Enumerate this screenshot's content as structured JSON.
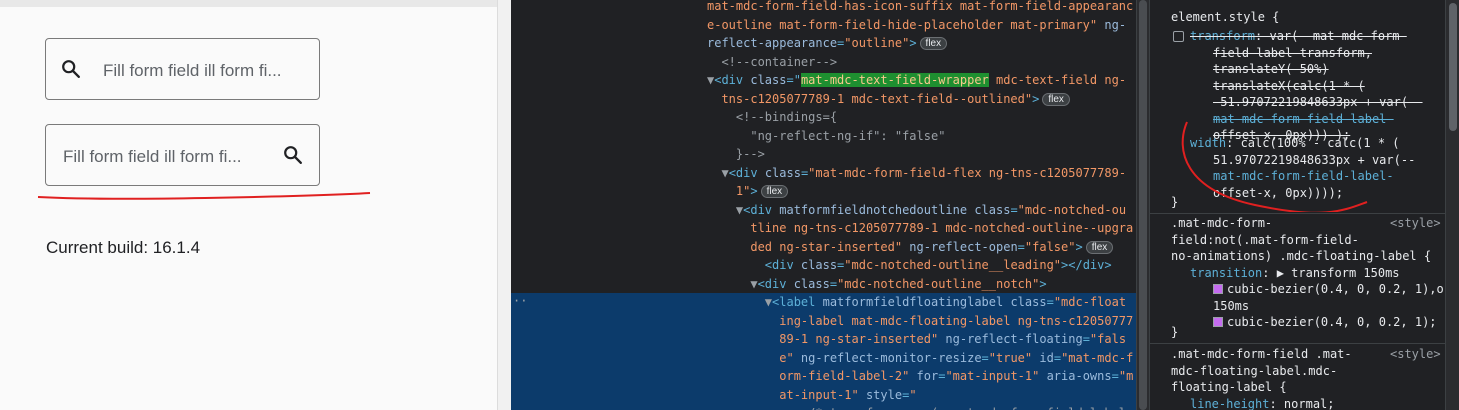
{
  "page": {
    "field1_placeholder": "Fill form field ill form fi...",
    "field2_placeholder": "Fill form field ill form fi...",
    "build_text": "Current build: 16.1.4"
  },
  "elements": {
    "badge": "flex",
    "lines": [
      [
        {
          "c": "av",
          "t": "mat-mdc-form-field-has-icon-suffix mat-form-field-appearanc"
        }
      ],
      [
        {
          "c": "av",
          "t": "e-outline mat-form-field-hide-placeholder mat-primary\""
        },
        {
          "c": "an",
          "t": " ng-"
        }
      ],
      [
        {
          "c": "an",
          "t": "reflect-appearance"
        },
        {
          "c": "tag",
          "t": "="
        },
        {
          "c": "av",
          "t": "\"outline\""
        },
        {
          "c": "tag",
          "t": ">"
        },
        {
          "c": "pill",
          "t": "flex"
        }
      ],
      [
        {
          "c": "cm",
          "t": "  <!--container-->"
        }
      ],
      [
        {
          "c": "tri",
          "t": "▼"
        },
        {
          "c": "tag",
          "t": "<div "
        },
        {
          "c": "an",
          "t": "class"
        },
        {
          "c": "tag",
          "t": "=\""
        },
        {
          "c": "hl",
          "t": "mat-mdc-text-field-wrapper"
        },
        {
          "c": "av",
          "t": " mdc-text-field ng-"
        }
      ],
      [
        {
          "c": "av",
          "t": "  tns-c1205077789-1 mdc-text-field--outlined\""
        },
        {
          "c": "tag",
          "t": ">"
        },
        {
          "c": "pill",
          "t": "flex"
        }
      ],
      [
        {
          "c": "cm",
          "t": "    <!--bindings={"
        }
      ],
      [
        {
          "c": "cm",
          "t": "      \"ng-reflect-ng-if\": \"false\""
        }
      ],
      [
        {
          "c": "cm",
          "t": "    }-->"
        }
      ],
      [
        {
          "c": "tri",
          "t": "  ▼"
        },
        {
          "c": "tag",
          "t": "<div "
        },
        {
          "c": "an",
          "t": "class"
        },
        {
          "c": "tag",
          "t": "="
        },
        {
          "c": "av",
          "t": "\"mat-mdc-form-field-flex ng-tns-c1205077789-"
        }
      ],
      [
        {
          "c": "av",
          "t": "    1\""
        },
        {
          "c": "tag",
          "t": ">"
        },
        {
          "c": "pill",
          "t": "flex"
        }
      ],
      [
        {
          "c": "tri",
          "t": "    ▼"
        },
        {
          "c": "tag",
          "t": "<div "
        },
        {
          "c": "an",
          "t": "matformfieldnotchedoutline class"
        },
        {
          "c": "tag",
          "t": "="
        },
        {
          "c": "av",
          "t": "\"mdc-notched-ou"
        }
      ],
      [
        {
          "c": "av",
          "t": "      tline ng-tns-c1205077789-1 mdc-notched-outline--upgra"
        }
      ],
      [
        {
          "c": "av",
          "t": "      ded ng-star-inserted\""
        },
        {
          "c": "an",
          "t": " ng-reflect-open"
        },
        {
          "c": "tag",
          "t": "="
        },
        {
          "c": "av",
          "t": "\"false\""
        },
        {
          "c": "tag",
          "t": ">"
        },
        {
          "c": "pill",
          "t": "flex"
        }
      ],
      [
        {
          "c": "tag",
          "t": "        <div "
        },
        {
          "c": "an",
          "t": "class"
        },
        {
          "c": "tag",
          "t": "="
        },
        {
          "c": "av",
          "t": "\"mdc-notched-outline__leading\""
        },
        {
          "c": "tag",
          "t": "></div>"
        }
      ],
      [
        {
          "c": "tri",
          "t": "      ▼"
        },
        {
          "c": "tag",
          "t": "<div "
        },
        {
          "c": "an",
          "t": "class"
        },
        {
          "c": "tag",
          "t": "="
        },
        {
          "c": "av",
          "t": "\"mdc-notched-outline__notch\""
        },
        {
          "c": "tag",
          "t": ">"
        }
      ],
      [
        {
          "c": "tri",
          "t": "        ▼"
        },
        {
          "c": "tag",
          "t": "<label "
        },
        {
          "c": "an",
          "t": "matformfieldfloatinglabel class"
        },
        {
          "c": "tag",
          "t": "="
        },
        {
          "c": "av",
          "t": "\"mdc-float"
        }
      ],
      [
        {
          "c": "av",
          "t": "          ing-label mat-mdc-floating-label ng-tns-c12050777"
        }
      ],
      [
        {
          "c": "av",
          "t": "          89-1 ng-star-inserted\""
        },
        {
          "c": "an",
          "t": " ng-reflect-floating"
        },
        {
          "c": "tag",
          "t": "="
        },
        {
          "c": "av",
          "t": "\"fals"
        }
      ],
      [
        {
          "c": "av",
          "t": "          e\""
        },
        {
          "c": "an",
          "t": " ng-reflect-monitor-resize"
        },
        {
          "c": "tag",
          "t": "="
        },
        {
          "c": "av",
          "t": "\"true\""
        },
        {
          "c": "an",
          "t": " id"
        },
        {
          "c": "tag",
          "t": "="
        },
        {
          "c": "av",
          "t": "\"mat-mdc-f"
        }
      ],
      [
        {
          "c": "av",
          "t": "          orm-field-label-2\""
        },
        {
          "c": "an",
          "t": " for"
        },
        {
          "c": "tag",
          "t": "="
        },
        {
          "c": "av",
          "t": "\"mat-input-1\""
        },
        {
          "c": "an",
          "t": " aria-owns"
        },
        {
          "c": "tag",
          "t": "="
        },
        {
          "c": "av",
          "t": "\"m"
        }
      ],
      [
        {
          "c": "av",
          "t": "          at-input-1\""
        },
        {
          "c": "an",
          "t": " style"
        },
        {
          "c": "tag",
          "t": "="
        },
        {
          "c": "av",
          "t": "\""
        }
      ],
      [
        {
          "c": "cm",
          "t": "              /* transform: var(--mat-mdc-form-field-label"
        }
      ]
    ],
    "selected_from": 16,
    "selected_dots": "··"
  },
  "styles": {
    "element_style_selector": "element.style {",
    "transform_prop": "transform",
    "transform_lines": [
      ": var(--mat-mdc-form-",
      "field-label-transform,",
      "translateY(-50%)",
      "translateX(calc(1 * (",
      "-51.97072219848633px + var(--",
      "mat-mdc-form-field-label-",
      "offset-x, 0px))) );"
    ],
    "width_prop": "width",
    "width_lines": [
      ": calc(100% - calc(1 * (",
      "51.97072219848633px + var(--",
      "mat-mdc-form-field-label-",
      "offset-x, 0px))));"
    ],
    "close": "}",
    "rule2_selector": [
      ".mat-mdc-form-",
      "field:not(.mat-form-field-",
      "no-animations) .mdc-floating-label {"
    ],
    "rule2_source": "<style>",
    "rule2_transition_prop": "transition",
    "rule2_transition_val": ": ▶ transform 150ms",
    "rule2_lines": [
      "cubic-bezier(0.4, 0, 0.2, 1),o",
      "150ms",
      "cubic-bezier(0.4, 0, 0.2, 1);"
    ],
    "rule3_selector": [
      ".mat-mdc-form-field .mat-",
      "mdc-floating-label.mdc-",
      "floating-label {"
    ],
    "rule3_source": "<style>",
    "rule3_prop": "line-height",
    "rule3_val": ": normal;"
  }
}
